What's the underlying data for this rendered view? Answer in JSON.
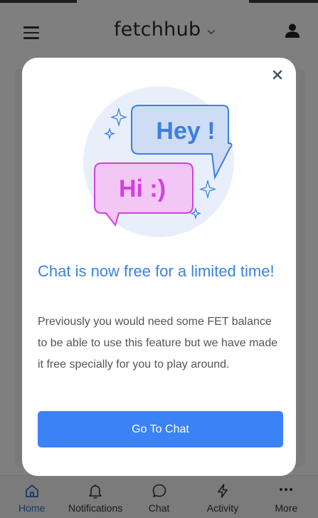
{
  "header": {
    "brand": "fetchhub",
    "menu_icon": "hamburger-menu-icon",
    "user_icon": "user-icon"
  },
  "bottom_nav": {
    "items": [
      {
        "label": "Home",
        "icon": "home-icon",
        "active": true
      },
      {
        "label": "Notifications",
        "icon": "bell-icon",
        "active": false
      },
      {
        "label": "Chat",
        "icon": "chat-bubble-icon",
        "active": false
      },
      {
        "label": "Activity",
        "icon": "lightning-icon",
        "active": false
      },
      {
        "label": "More",
        "icon": "more-dots-icon",
        "active": false
      }
    ]
  },
  "modal": {
    "close_icon": "close-icon",
    "illustration": {
      "bubble_right_text": "Hey !",
      "bubble_left_text": "Hi :)"
    },
    "title": "Chat is now free for a limited time!",
    "description": "Previously you would need some FET balance to be able to use this feature but we have made it free specially for you to play around.",
    "button_label": "Go To Chat"
  },
  "colors": {
    "accent": "#3b82f6",
    "title": "#3b82e0",
    "active_nav": "#2f6fd0",
    "bubble_blue": "#3b7fe0",
    "bubble_pink": "#d43fe0"
  }
}
